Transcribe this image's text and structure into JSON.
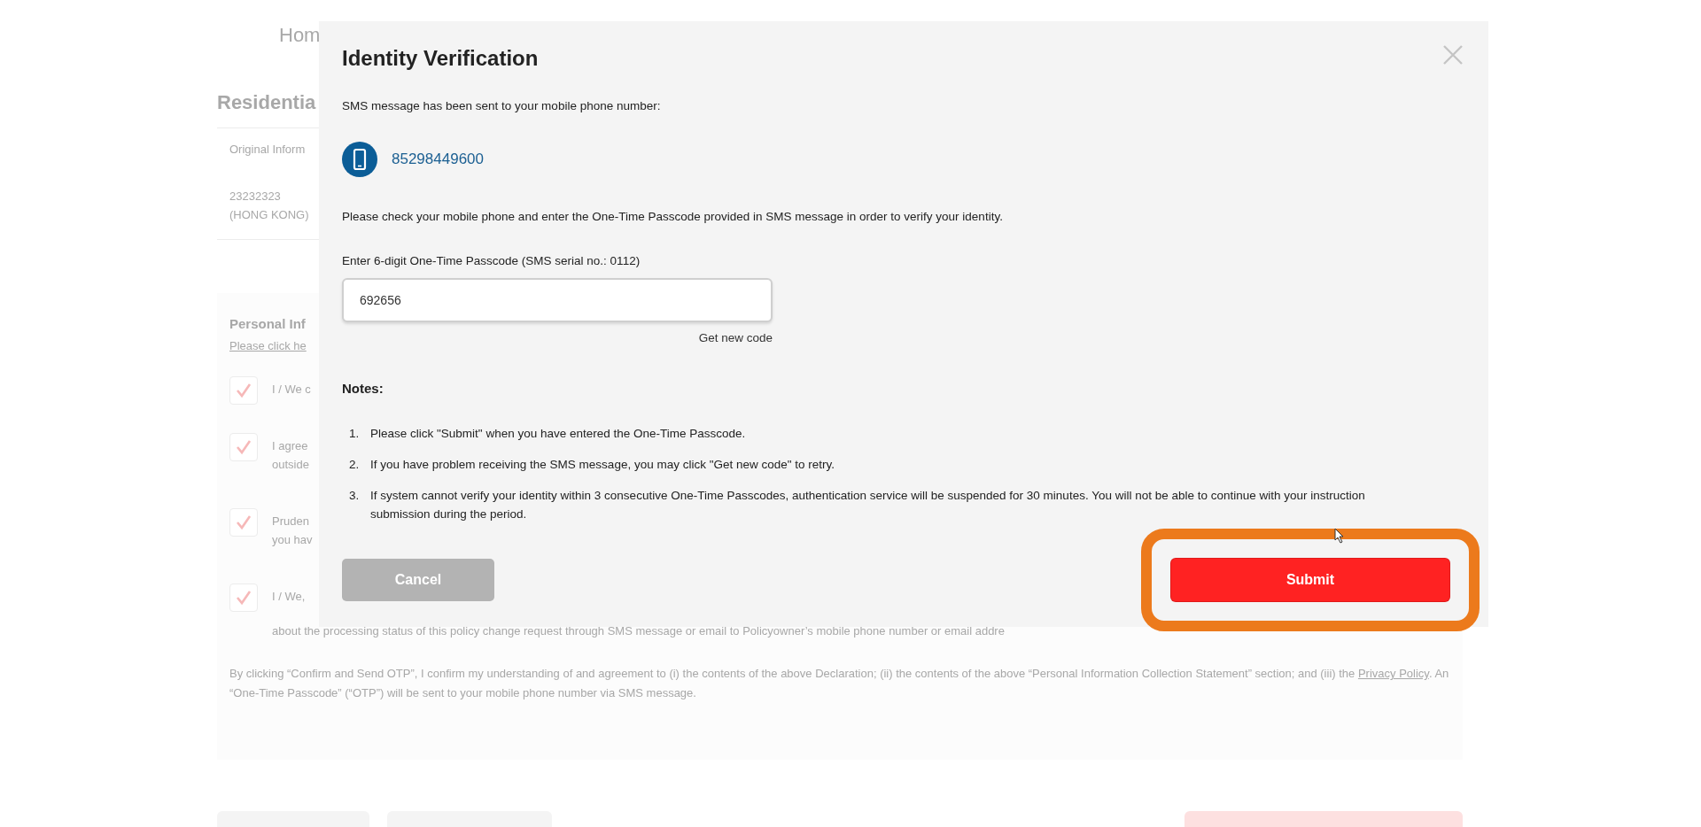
{
  "page": {
    "breadcrumb": "Hom",
    "heading": "Residentia",
    "info_label": "Original Inform",
    "info_value_lines": [
      "23232323",
      "(HONG KONG)"
    ],
    "section_title": "Personal Inf",
    "section_link": "Please click he",
    "declarations": [
      {
        "checked": true,
        "lines": [
          "I / We c"
        ]
      },
      {
        "checked": true,
        "lines": [
          "I agree",
          "outside"
        ]
      },
      {
        "checked": true,
        "lines": [
          "Pruden",
          "you hav"
        ]
      },
      {
        "checked": true,
        "lines": [
          "I / We,",
          "about the processing status of this policy change request through SMS message or email to Policyowner’s mobile phone number or email addre"
        ]
      }
    ],
    "disclaimer": {
      "before": "By clicking “Confirm and Send OTP”, I confirm my understanding of and agreement to (i) the contents of the above Declaration; (ii) the contents of the above “Personal Information Collection Statement” section; and (iii) the",
      "link": "Privacy Policy",
      "after": ". An “One-Time Passcode” (“OTP”) will be sent to your mobile phone number via SMS message."
    },
    "bottom_buttons": [
      {
        "kind": "secondary"
      },
      {
        "kind": "secondary"
      },
      {
        "kind": "primary"
      }
    ]
  },
  "dialog": {
    "title": "Identity Verification",
    "sent_text": "SMS message has been sent to your mobile phone number:",
    "phone": "85298449600",
    "instruction": "Please check your mobile phone and enter the One-Time Passcode provided in SMS message in order to verify your identity.",
    "field_label": "Enter 6-digit One-Time Passcode (SMS serial no.: 0112)",
    "field_value": "692656",
    "new_code_link": "Get new code",
    "notes_title": "Notes:",
    "notes": [
      {
        "number": "1.",
        "text": "Please click \"Submit\" when you have entered the One-Time Passcode."
      },
      {
        "number": "2.",
        "text": "If you have problem receiving the SMS message, you may click \"Get new code\" to retry."
      },
      {
        "number": "3.",
        "text": "If system cannot verify your identity within 3 consecutive One-Time Passcodes, authentication service will be suspended for 30 minutes. You will not be able to continue with your instruction submission during the period."
      }
    ],
    "buttons": [
      {
        "kind": "cancel",
        "label": "Cancel",
        "highlighted": false
      },
      {
        "kind": "submit",
        "label": "Submit",
        "highlighted": true
      }
    ]
  }
}
